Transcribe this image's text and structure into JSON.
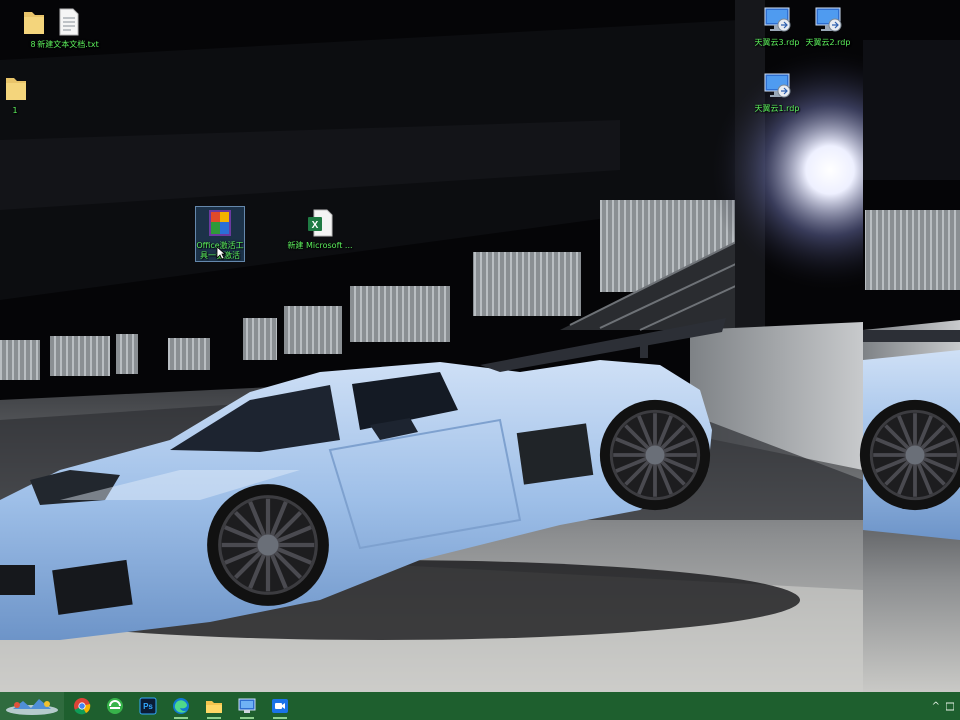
{
  "desktop": {
    "icons": [
      {
        "label": "8",
        "icon": "folder-icon"
      },
      {
        "label": "新建文本文档.txt",
        "icon": "text-file-icon"
      },
      {
        "label": "1",
        "icon": "folder-icon"
      },
      {
        "label": "Office激活工具一键激活",
        "icon": "office-activator-icon"
      },
      {
        "label": "新建 Microsoft ...",
        "icon": "excel-file-icon"
      },
      {
        "label": "天翼云3.rdp",
        "icon": "rdp-icon"
      },
      {
        "label": "天翼云2.rdp",
        "icon": "rdp-icon"
      },
      {
        "label": "天翼云1.rdp",
        "icon": "rdp-icon"
      }
    ]
  },
  "taskbar": {
    "apps": [
      {
        "name": "chrome-icon"
      },
      {
        "name": "360-browser-icon"
      },
      {
        "name": "photoshop-icon",
        "text": "Ps"
      },
      {
        "name": "edge-icon"
      },
      {
        "name": "file-explorer-icon"
      },
      {
        "name": "remote-desktop-icon"
      },
      {
        "name": "video-meeting-icon"
      }
    ],
    "tray_arrow": "^"
  },
  "colors": {
    "taskbar": "#1e5f2e",
    "icon_label": "#5cf05c",
    "car_body": "#a6c6ec"
  }
}
